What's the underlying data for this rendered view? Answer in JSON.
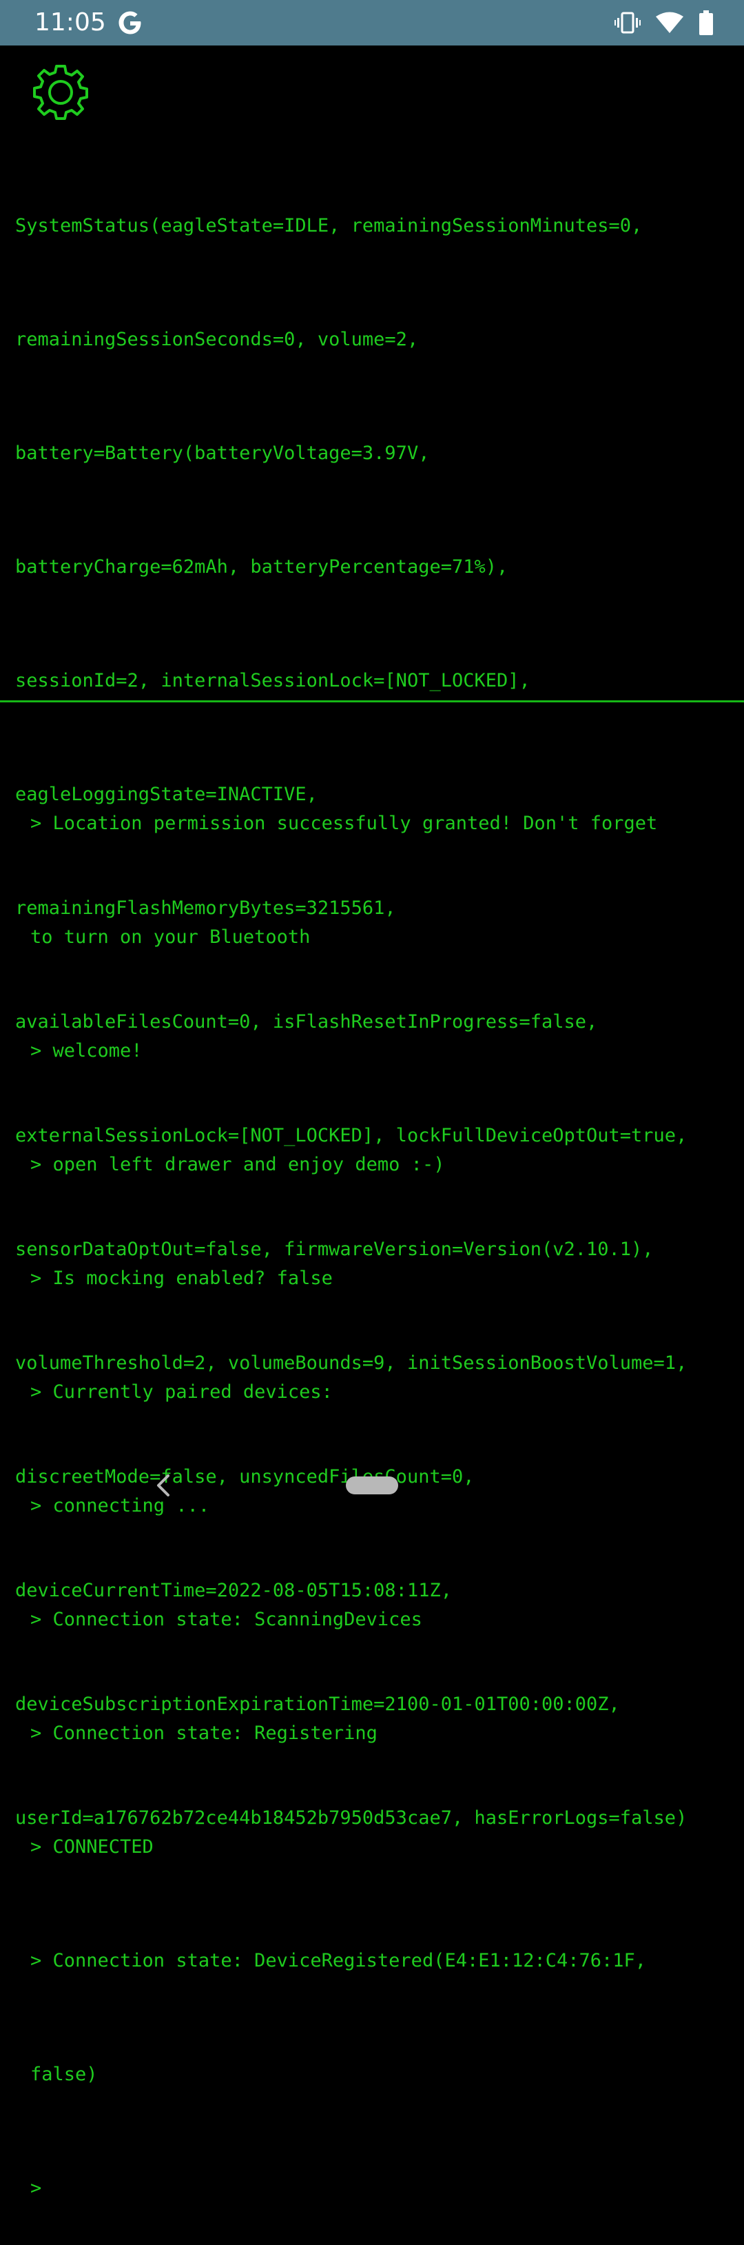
{
  "status_bar": {
    "time": "11:05",
    "icons": [
      "google-icon",
      "vibrate-icon",
      "wifi-icon",
      "battery-icon"
    ]
  },
  "toolbar": {
    "settings_icon": "gear-icon"
  },
  "system_status": {
    "lines": [
      "SystemStatus(eagleState=IDLE, remainingSessionMinutes=0,",
      "remainingSessionSeconds=0, volume=2,",
      "battery=Battery(batteryVoltage=3.97V,",
      "batteryCharge=62mAh, batteryPercentage=71%),",
      "sessionId=2, internalSessionLock=[NOT_LOCKED],",
      "eagleLoggingState=INACTIVE,",
      "remainingFlashMemoryBytes=3215561,",
      "availableFilesCount=0, isFlashResetInProgress=false,",
      "externalSessionLock=[NOT_LOCKED], lockFullDeviceOptOut=true,",
      "sensorDataOptOut=false, firmwareVersion=Version(v2.10.1),",
      "volumeThreshold=2, volumeBounds=9, initSessionBoostVolume=1,",
      "discreetMode=false, unsyncedFilesCount=0,",
      "deviceCurrentTime=2022-08-05T15:08:11Z,",
      "deviceSubscriptionExpirationTime=2100-01-01T00:00:00Z,",
      "userId=a176762b72ce44b18452b7950d53cae7, hasErrorLogs=false)"
    ]
  },
  "console": {
    "lines": [
      "> Location permission successfully granted! Don't forget",
      "to turn on your Bluetooth",
      "> welcome!",
      "> open left drawer and enjoy demo :-)",
      "> Is mocking enabled? false",
      "> Currently paired devices:",
      "> connecting ...",
      "> Connection state: ScanningDevices",
      "> Connection state: Registering",
      "> CONNECTED",
      "> Connection state: DeviceRegistered(E4:E1:12:C4:76:1F,",
      "false)",
      ">"
    ]
  },
  "nav_bar": {
    "back_icon": "back-icon",
    "home_icon": "home-pill-icon"
  },
  "colors": {
    "status_bar_bg": "#4f7b8d",
    "terminal_green": "#1fcc1f",
    "background": "#000000"
  }
}
